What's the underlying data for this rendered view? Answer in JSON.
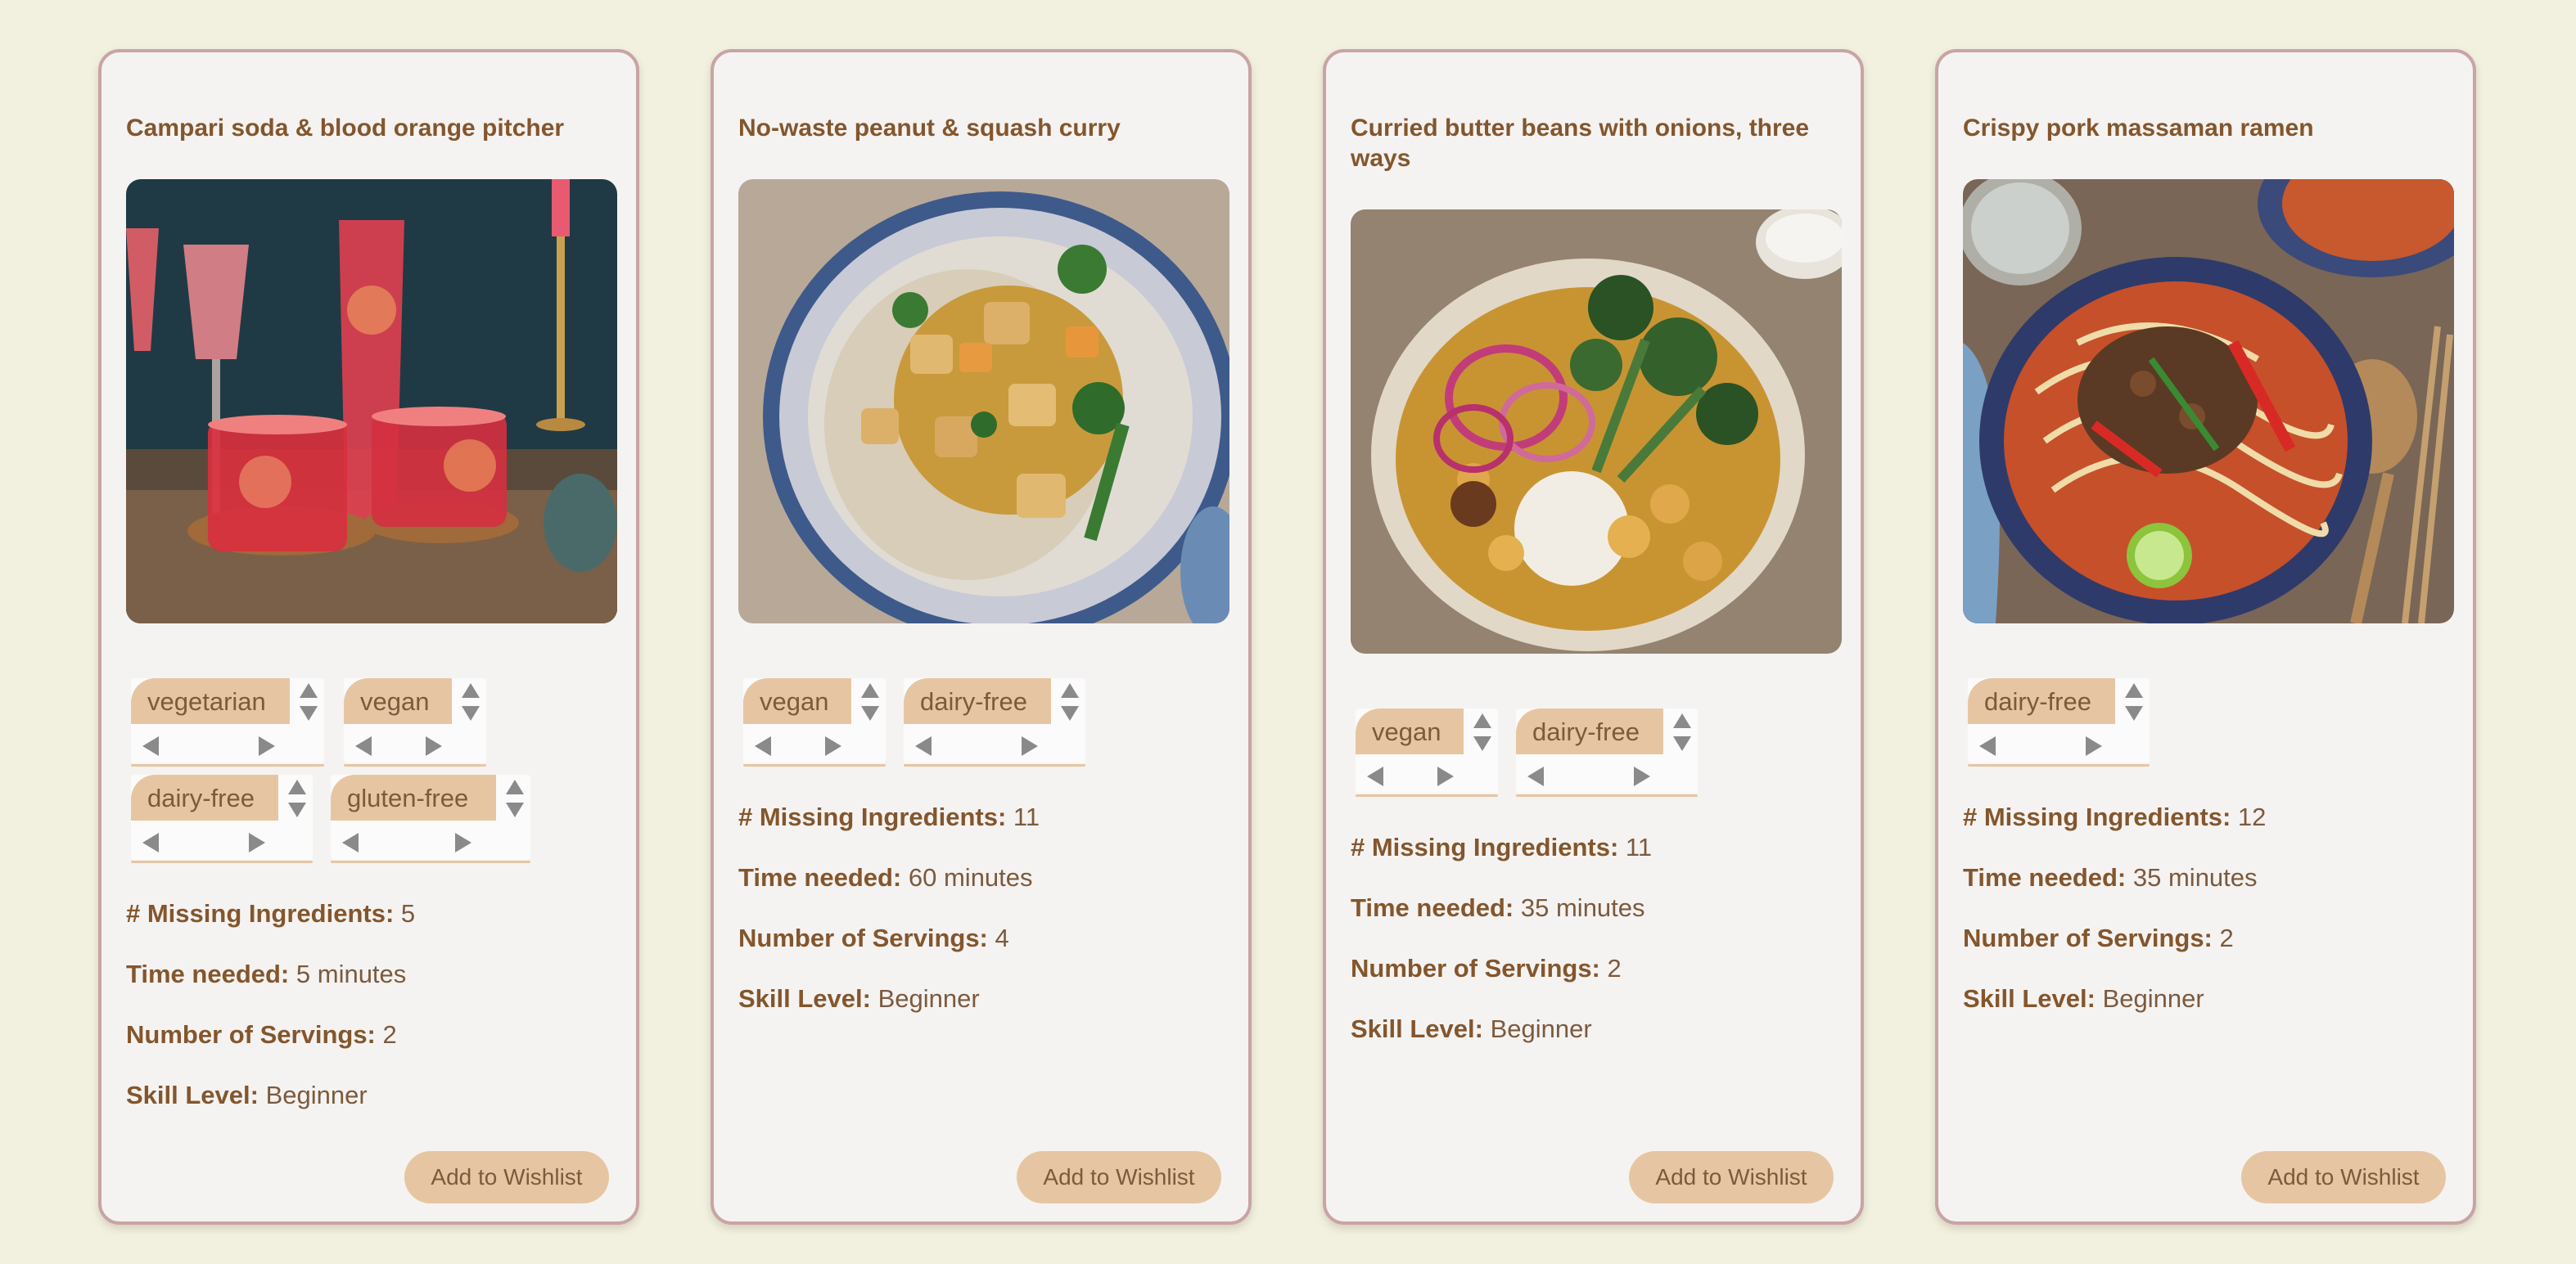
{
  "labels": {
    "missing": "# Missing Ingredients:",
    "time": "Time needed:",
    "servings": "Number of Servings:",
    "skill": "Skill Level:"
  },
  "colors": {
    "page_background": "#f2f1df",
    "card_background": "#f5f3f2",
    "card_border": "#c9a4a4",
    "accent": "#e6c6a2",
    "title_text": "#84562c",
    "body_text": "#7c5a3c"
  },
  "cards": [
    {
      "title": "Campari soda & blood orange pitcher",
      "image": "campari-soda-drinks-photo",
      "tags": [
        "vegetarian",
        "vegan",
        "dairy-free",
        "gluten-free"
      ],
      "missing_ingredients": "5",
      "time_needed": "5 minutes",
      "servings": "2",
      "skill_level": "Beginner",
      "button_label": "Add to Wishlist"
    },
    {
      "title": "No-waste peanut & squash curry",
      "image": "peanut-squash-curry-photo",
      "tags": [
        "vegan",
        "dairy-free"
      ],
      "missing_ingredients": "11",
      "time_needed": "60 minutes",
      "servings": "4",
      "skill_level": "Beginner",
      "button_label": "Add to Wishlist"
    },
    {
      "title": "Curried butter beans with onions, three ways",
      "image": "curried-butter-beans-photo",
      "tags": [
        "vegan",
        "dairy-free"
      ],
      "missing_ingredients": "11",
      "time_needed": "35 minutes",
      "servings": "2",
      "skill_level": "Beginner",
      "button_label": "Add to Wishlist"
    },
    {
      "title": "Crispy pork massaman ramen",
      "image": "pork-massaman-ramen-photo",
      "tags": [
        "dairy-free"
      ],
      "missing_ingredients": "12",
      "time_needed": "35 minutes",
      "servings": "2",
      "skill_level": "Beginner",
      "button_label": "Add to Wishlist"
    }
  ]
}
